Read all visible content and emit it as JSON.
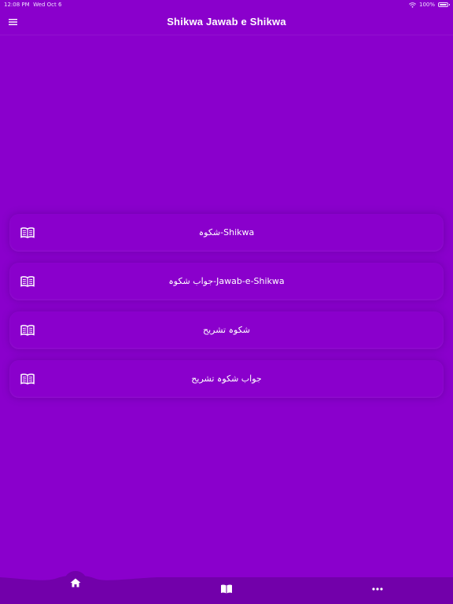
{
  "status_bar": {
    "time": "12:08 PM",
    "date": "Wed Oct 6",
    "battery": "100%"
  },
  "app_bar": {
    "title": "Shikwa Jawab e Shikwa",
    "menu_icon": "hamburger-menu-icon"
  },
  "menu": {
    "items": [
      {
        "label": "شکوہ-Shikwa",
        "icon": "book-open-icon"
      },
      {
        "label": "جواب شکوہ-Jawab-e-Shikwa",
        "icon": "book-open-icon"
      },
      {
        "label": "شکوہ تشریح",
        "icon": "book-open-icon"
      },
      {
        "label": "جواب شکوہ تشریح",
        "icon": "book-open-icon"
      }
    ]
  },
  "bottom_nav": {
    "items": [
      {
        "name": "home",
        "icon": "home-icon",
        "active": true
      },
      {
        "name": "book",
        "icon": "book-open-icon",
        "active": false
      },
      {
        "name": "more",
        "icon": "more-dots-icon",
        "active": false
      }
    ]
  },
  "colors": {
    "background": "#8a00cc",
    "nav_bar": "#7200aa",
    "text": "#ffffff"
  }
}
